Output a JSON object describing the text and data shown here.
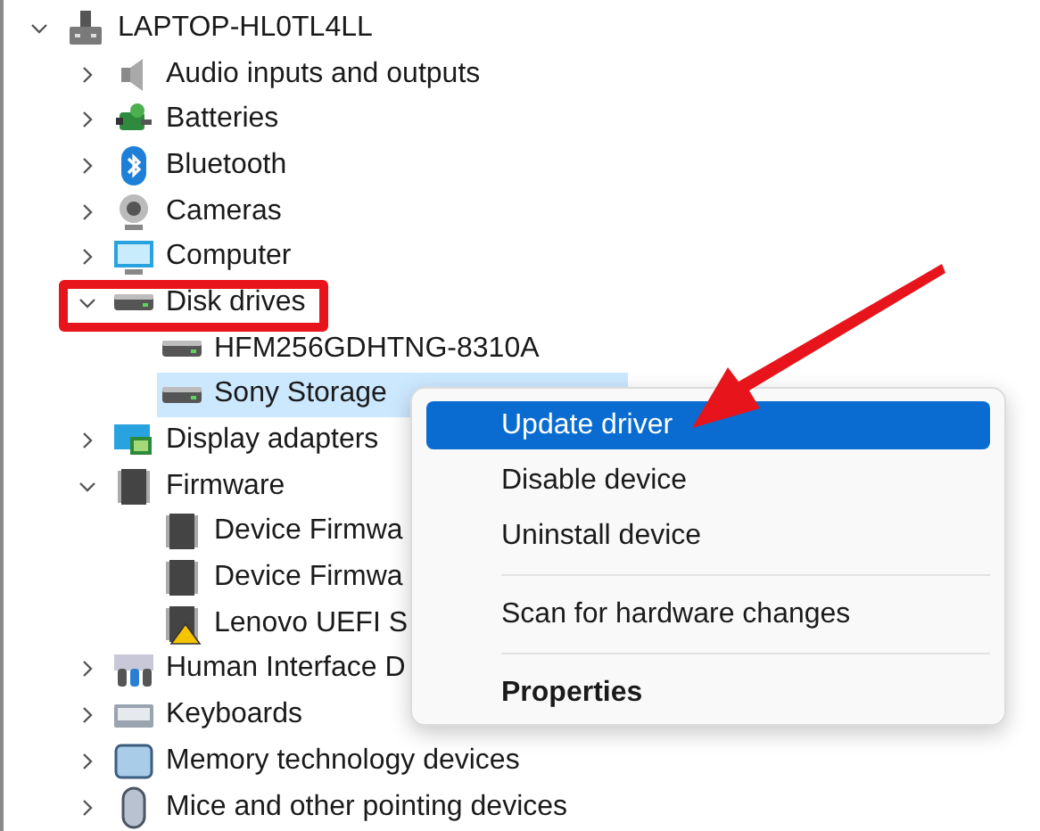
{
  "tree": [
    {
      "label": "LAPTOP-HL0TL4LL",
      "kind": "computer-root",
      "expanded": true,
      "selected": false,
      "children": [
        {
          "label": "Audio inputs and outputs",
          "kind": "speaker",
          "expanded": false,
          "selected": false
        },
        {
          "label": "Batteries",
          "kind": "battery",
          "expanded": false,
          "selected": false
        },
        {
          "label": "Bluetooth",
          "kind": "bluetooth",
          "expanded": false,
          "selected": false
        },
        {
          "label": "Cameras",
          "kind": "camera",
          "expanded": false,
          "selected": false
        },
        {
          "label": "Computer",
          "kind": "monitor",
          "expanded": false,
          "selected": false
        },
        {
          "label": "Disk drives",
          "kind": "drive",
          "expanded": true,
          "selected": false,
          "children": [
            {
              "label": "HFM256GDHTNG-8310A",
              "kind": "drive",
              "selected": false
            },
            {
              "label": "Sony Storage",
              "kind": "drive",
              "selected": true
            }
          ]
        },
        {
          "label": "Display adapters",
          "kind": "display",
          "expanded": false,
          "selected": false
        },
        {
          "label": "Firmware",
          "kind": "chip",
          "expanded": true,
          "selected": false,
          "children": [
            {
              "label": "Device Firmwa",
              "kind": "chip",
              "selected": false,
              "warning": false
            },
            {
              "label": "Device Firmwa",
              "kind": "chip",
              "selected": false,
              "warning": false
            },
            {
              "label": "Lenovo UEFI S",
              "kind": "chip",
              "selected": false,
              "warning": true
            }
          ]
        },
        {
          "label": "Human Interface D",
          "kind": "hid",
          "expanded": false,
          "selected": false
        },
        {
          "label": "Keyboards",
          "kind": "keyboard",
          "expanded": false,
          "selected": false
        },
        {
          "label": "Memory technology devices",
          "kind": "memory",
          "expanded": false,
          "selected": false
        },
        {
          "label": "Mice and other pointing devices",
          "kind": "mouse",
          "expanded": false,
          "selected": false
        }
      ]
    }
  ],
  "context_menu": [
    {
      "label": "Update driver",
      "kind": "item",
      "selected": true
    },
    {
      "label": "Disable device",
      "kind": "item",
      "selected": false
    },
    {
      "label": "Uninstall device",
      "kind": "item",
      "selected": false
    },
    {
      "kind": "separator"
    },
    {
      "label": "Scan for hardware changes",
      "kind": "item",
      "selected": false
    },
    {
      "kind": "separator"
    },
    {
      "label": "Properties",
      "kind": "default",
      "selected": false
    }
  ]
}
